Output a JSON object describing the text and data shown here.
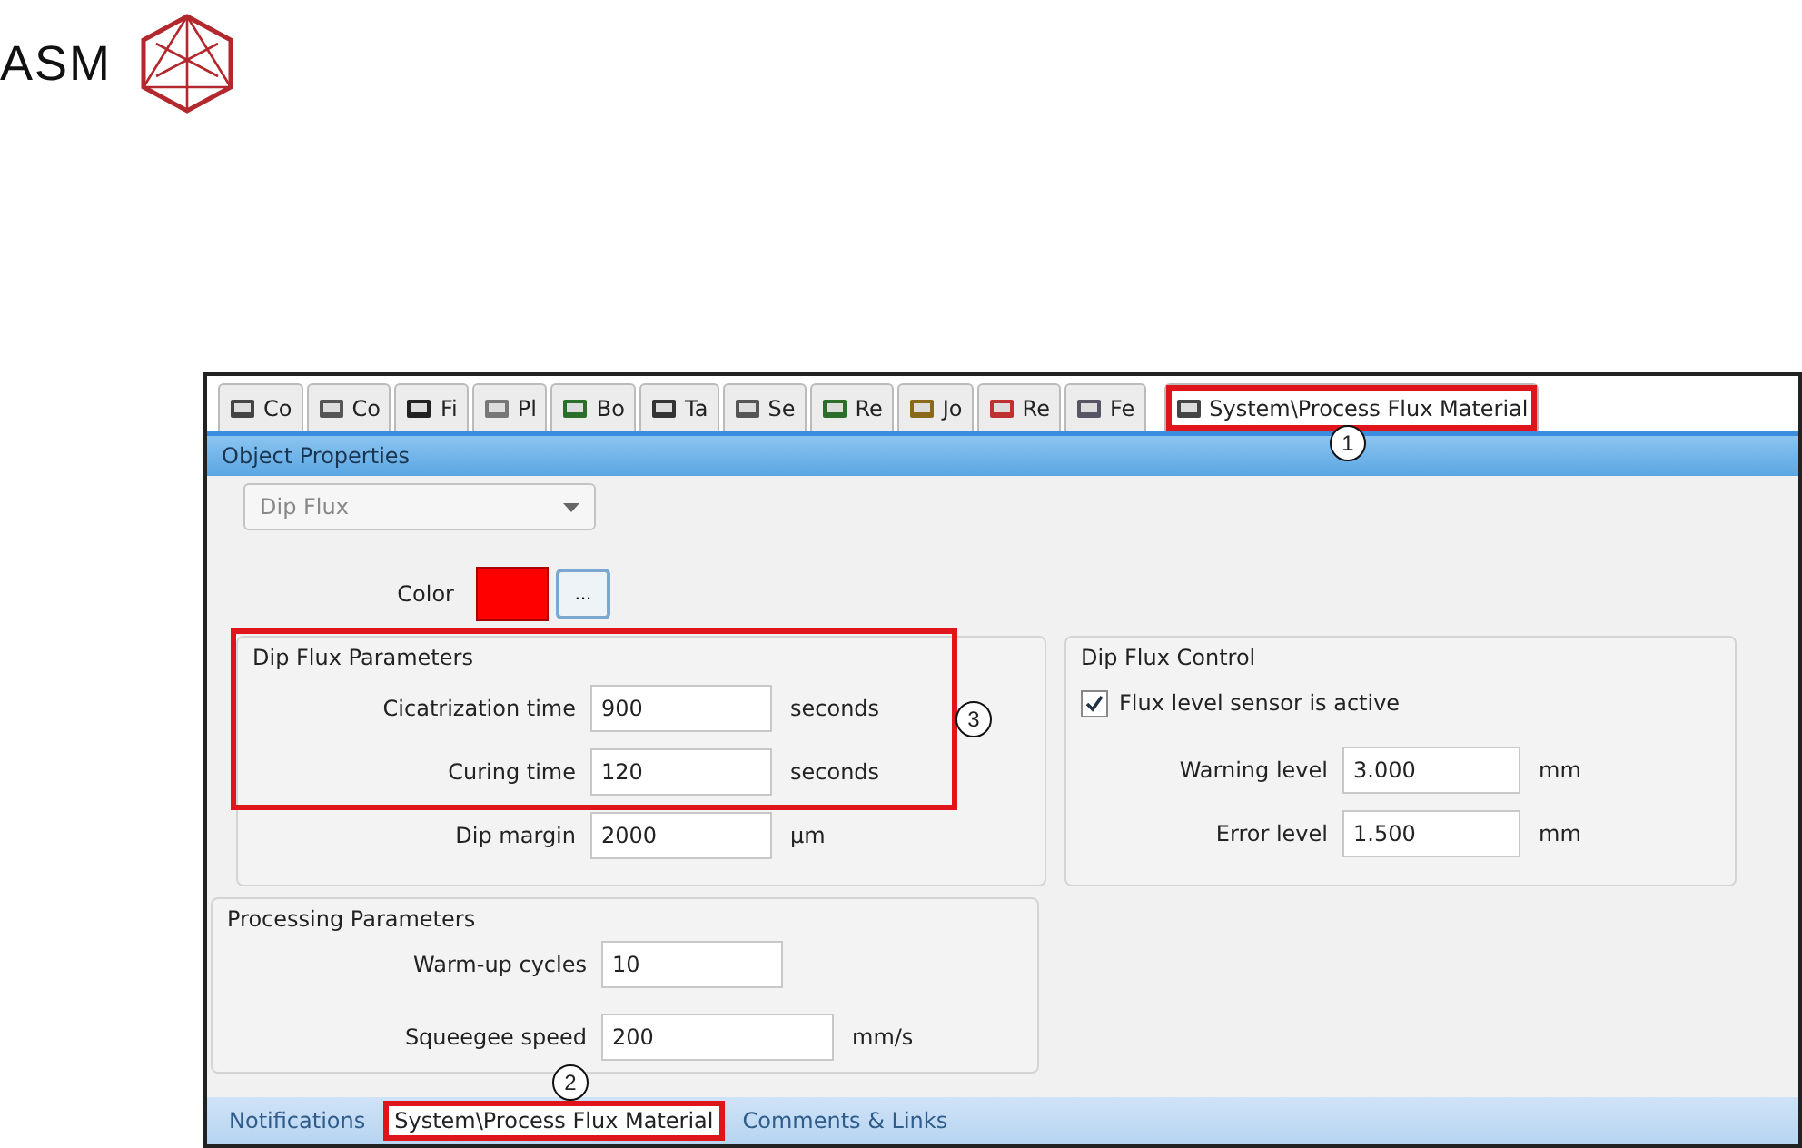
{
  "logo": {
    "text": "ASM"
  },
  "top_tabs": [
    {
      "label": "Co",
      "selected": false
    },
    {
      "label": "Co",
      "selected": false
    },
    {
      "label": "Fi",
      "selected": false
    },
    {
      "label": "Pl",
      "selected": false
    },
    {
      "label": "Bo",
      "selected": false
    },
    {
      "label": "Ta",
      "selected": false
    },
    {
      "label": "Se",
      "selected": false
    },
    {
      "label": "Re",
      "selected": false
    },
    {
      "label": "Jo",
      "selected": false
    },
    {
      "label": "Re",
      "selected": false
    },
    {
      "label": "Fe",
      "selected": false
    },
    {
      "label": "System\\Process Flux Material",
      "selected": true,
      "callout": "1"
    }
  ],
  "panel_title": "Object Properties",
  "type_dropdown": {
    "value": "Dip Flux"
  },
  "color": {
    "label": "Color",
    "button": "..."
  },
  "dip_flux_parameters": {
    "title": "Dip Flux Parameters",
    "callout": "3",
    "highlighted": true,
    "fields": [
      {
        "label": "Cicatrization time",
        "value": "900",
        "unit": "seconds"
      },
      {
        "label": "Curing time",
        "value": "120",
        "unit": "seconds"
      },
      {
        "label": "Dip margin",
        "value": "2000",
        "unit": "µm"
      }
    ]
  },
  "dip_flux_control": {
    "title": "Dip Flux Control",
    "checkbox": {
      "label": "Flux level sensor is active",
      "checked": true
    },
    "fields": [
      {
        "label": "Warning level",
        "value": "3.000",
        "unit": "mm"
      },
      {
        "label": "Error level",
        "value": "1.500",
        "unit": "mm"
      }
    ]
  },
  "processing_parameters": {
    "title": "Processing Parameters",
    "fields": [
      {
        "label": "Warm-up cycles",
        "value": "10"
      },
      {
        "label": "Squeegee speed",
        "value": "200",
        "unit": "mm/s"
      }
    ]
  },
  "bottom_tabs": [
    {
      "label": "Notifications",
      "selected": false
    },
    {
      "label": "System\\Process Flux Material",
      "selected": true,
      "callout": "2"
    },
    {
      "label": "Comments & Links",
      "selected": false
    }
  ]
}
